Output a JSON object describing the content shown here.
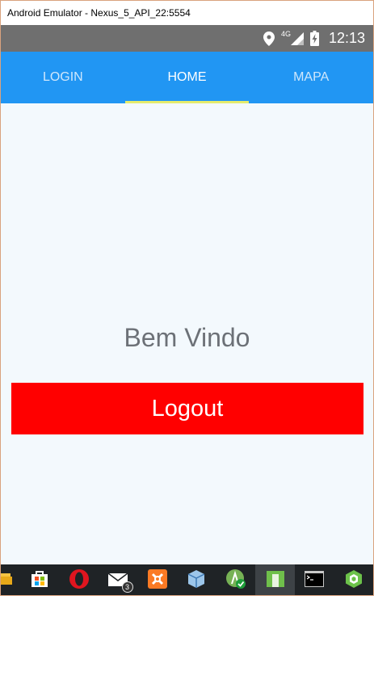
{
  "window": {
    "title": "Android Emulator - Nexus_5_API_22:5554"
  },
  "status_bar": {
    "time": "12:13",
    "network_label": "4G",
    "icons": [
      "location-pin-icon",
      "signal-4g-icon",
      "battery-charging-icon"
    ]
  },
  "tabs": [
    {
      "label": "LOGIN",
      "active": false
    },
    {
      "label": "HOME",
      "active": true
    },
    {
      "label": "MAPA",
      "active": false
    }
  ],
  "main": {
    "welcome_text": "Bem Vindo",
    "logout_label": "Logout"
  },
  "taskbar": {
    "mail_badge": "3",
    "items": [
      "file-explorer-icon",
      "microsoft-store-icon",
      "opera-icon",
      "mail-icon",
      "xampp-icon",
      "virtualbox-icon",
      "android-studio-icon",
      "emulator-icon",
      "command-prompt-icon",
      "node-icon"
    ]
  },
  "colors": {
    "tab_bar": "#2196f3",
    "tab_indicator": "#e5ec6c",
    "content_background": "#f3f9fd",
    "logout_button": "#ff0000",
    "welcome_text": "#6c7177",
    "status_bar": "#6f6f6f",
    "taskbar": "#1f2326"
  }
}
